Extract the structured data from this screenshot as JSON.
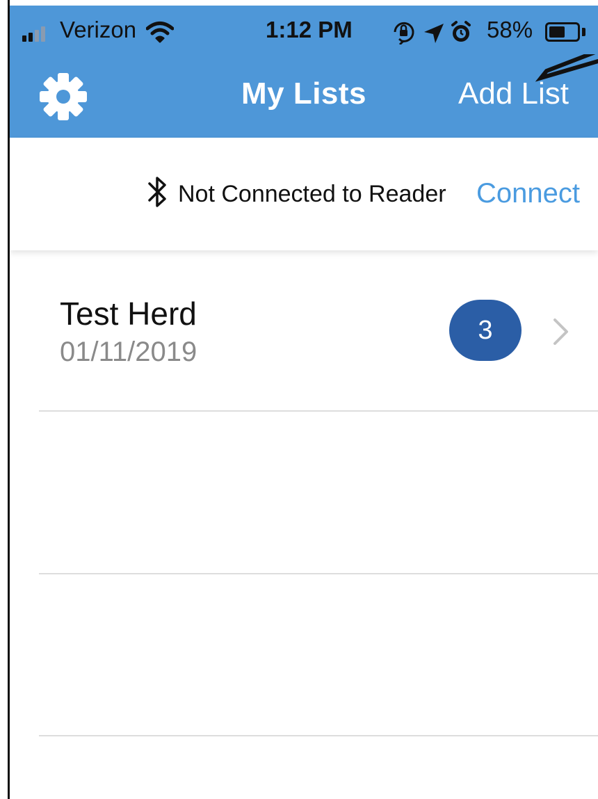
{
  "status_bar": {
    "carrier": "Verizon",
    "time": "1:12 PM",
    "battery_percent": "58%",
    "battery_level": 0.58,
    "signal_bars": 4,
    "signal_bars_active": 2,
    "icons": [
      "signal-icon",
      "wifi-icon",
      "orientation-lock-icon",
      "location-icon",
      "alarm-icon",
      "battery-icon"
    ]
  },
  "nav_bar": {
    "title": "My Lists",
    "settings_icon": "gear-icon",
    "add_button_label": "Add List"
  },
  "connection": {
    "icon": "bluetooth-icon",
    "status_text": "Not Connected to Reader",
    "connect_label": "Connect"
  },
  "lists": [
    {
      "title": "Test Herd",
      "date": "01/11/2019",
      "count": "3"
    }
  ],
  "colors": {
    "header_blue": "#4e97d8",
    "link_blue": "#4a9be0",
    "badge_blue": "#2b5ea6",
    "secondary_text": "#8a8a8a",
    "divider": "#dddddd"
  }
}
